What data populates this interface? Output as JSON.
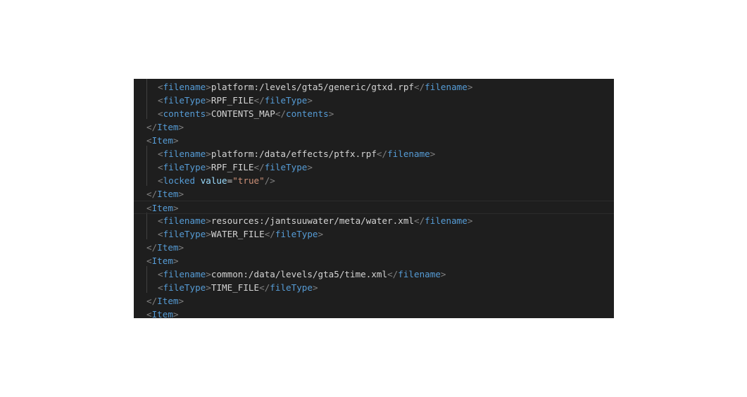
{
  "lines": [
    {
      "tag": "filename",
      "text": "platform:/levels/gta5/generic/gtxd.rpf"
    },
    {
      "tag": "fileType",
      "text": "RPF_FILE"
    },
    {
      "tag": "contents",
      "text": "CONTENTS_MAP"
    },
    {
      "close": "Item"
    },
    {
      "open": "Item"
    },
    {
      "tag": "filename",
      "text": "platform:/data/effects/ptfx.rpf"
    },
    {
      "tag": "fileType",
      "text": "RPF_FILE"
    },
    {
      "selfclose": "locked",
      "attr": "value",
      "attr_value": "\"true\""
    },
    {
      "close": "Item"
    },
    {
      "open": "Item"
    },
    {
      "tag": "filename",
      "text": "resources:/jantsuuwater/meta/water.xml"
    },
    {
      "tag": "fileType",
      "text": "WATER_FILE"
    },
    {
      "close": "Item"
    },
    {
      "open": "Item"
    },
    {
      "tag": "filename",
      "text": "common:/data/levels/gta5/time.xml"
    },
    {
      "tag": "fileType",
      "text": "TIME_FILE"
    },
    {
      "close": "Item"
    },
    {
      "open": "Item"
    }
  ],
  "colors": {
    "background": "#1e1e1e",
    "punctuation": "#808080",
    "tag": "#569cd6",
    "attribute": "#9cdcfe",
    "string": "#ce9178",
    "text": "#d4d4d4"
  }
}
